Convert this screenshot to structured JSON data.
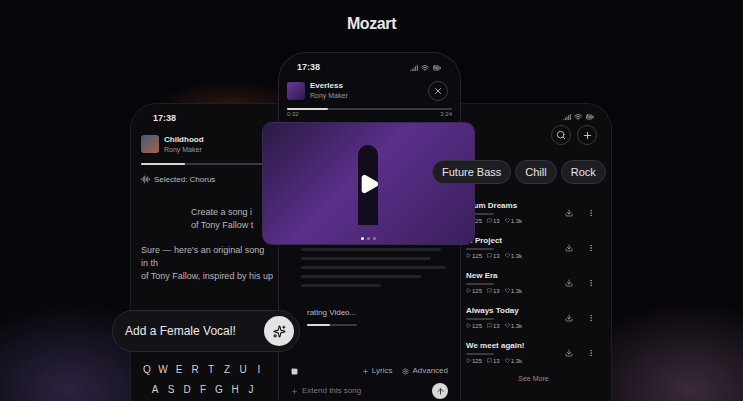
{
  "logo": {
    "text": "Mozart"
  },
  "left_phone": {
    "time": "17:38",
    "song": {
      "title": "Childhood",
      "artist": "Rony Maker",
      "level": 0.35
    },
    "selection": "Selected: Chorus",
    "messages": [
      {
        "role": "user",
        "lines": [
          "Create a song i",
          "of Tony Fallow t"
        ]
      },
      {
        "role": "assistant",
        "lines": [
          "Sure — here's an original song in th",
          "of Tony Fallow, inspired by his up"
        ]
      }
    ],
    "prompt": {
      "text": "Add a Female Vocal!"
    },
    "keyboard": {
      "rows": [
        [
          "Q",
          "W",
          "E",
          "R",
          "T",
          "Z",
          "U",
          "I"
        ],
        [
          "A",
          "S",
          "D",
          "F",
          "G",
          "H",
          "J"
        ]
      ]
    }
  },
  "center_phone": {
    "time": "17:38",
    "song": {
      "title": "Everless",
      "artist": "Rony Maker",
      "level": 0.25,
      "elapsed": "0:32",
      "duration": "3:24"
    },
    "video": {
      "slides": [
        {
          "selected": true
        },
        {
          "selected": false
        },
        {
          "selected": false
        }
      ]
    },
    "generation": {
      "label": "rating Video...",
      "level": 0.45
    },
    "actions": [
      {
        "label": "Lyrics"
      },
      {
        "label": "Advanced"
      }
    ],
    "input": {
      "placeholder": "Extend this song"
    }
  },
  "right_phone": {
    "chips": [
      {
        "label": "Future Bass"
      },
      {
        "label": "Chill"
      },
      {
        "label": "Rock"
      }
    ],
    "tracks": [
      {
        "title": "ntum Dreams",
        "plays": "125",
        "comments": "13",
        "likes": "1.3k"
      },
      {
        "title": "le Project",
        "plays": "125",
        "comments": "13",
        "likes": "1.3k"
      },
      {
        "title": "New Era",
        "plays": "125",
        "comments": "13",
        "likes": "1.3k"
      },
      {
        "title": "Always Today",
        "plays": "125",
        "comments": "13",
        "likes": "1.3k"
      },
      {
        "title": "We meet again!",
        "plays": "125",
        "comments": "13",
        "likes": "1.3k"
      }
    ],
    "see_more": "See More"
  }
}
